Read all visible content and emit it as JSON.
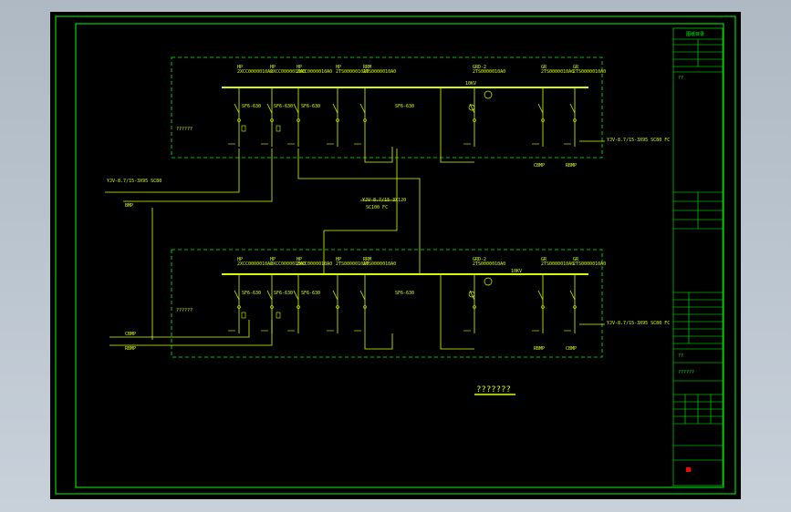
{
  "drawing": {
    "title": "???????",
    "colors": {
      "background": "#000000",
      "frame": "#00ff00",
      "wire": "#d8ff00",
      "dash_box": "#00ff00",
      "marker": "#ff0000"
    }
  },
  "upper_panel": {
    "region_label": "??????",
    "bus_label_right": "10KV",
    "feeder_labels": [
      {
        "top": "HP",
        "sub": "2XCC0000010A0"
      },
      {
        "top": "HP",
        "sub": "2XCC0000010A0"
      },
      {
        "top": "HP",
        "sub": "2XCC0000010A0"
      },
      {
        "top": "HP",
        "sub": "2TS0000010A0"
      },
      {
        "top": "RRM",
        "sub": "2TS0000010A0"
      },
      {
        "top": "GRD-2",
        "sub": "2TS0000010A0"
      },
      {
        "top": "GR",
        "sub": "2TS0000010A0"
      },
      {
        "top": "GR",
        "sub": "2TS0000010A0"
      }
    ],
    "breaker_labels": [
      "SF6-630",
      "SF6-630",
      "SF6-630",
      "SF6-630"
    ],
    "cable_out": "YJV-8.7/15-3X95 SC80 FC",
    "bottom_labels": [
      "CBMP",
      "RBMP"
    ]
  },
  "lower_panel": {
    "region_label": "??????",
    "bus_label_right": "10KV",
    "cable_out": "YJV-8.7/15-3X95 SC80 FC",
    "bottom_labels": [
      "RBMP",
      "CBMP"
    ]
  },
  "incoming": {
    "upper_cable": "YJV-8.7/15-3X95 SC80",
    "upper_sub": "BMP",
    "lower_cable_a": "CBMP",
    "lower_cable_b": "RBMP",
    "tie_cable": "YJV-8.7/15-3X120",
    "tie_sub": "SC100 FC"
  },
  "title_block": {
    "header": "图纸目录",
    "rows": [
      "",
      "",
      "",
      "",
      ""
    ],
    "section_a": "??",
    "section_b": "??",
    "footer": "??????"
  }
}
